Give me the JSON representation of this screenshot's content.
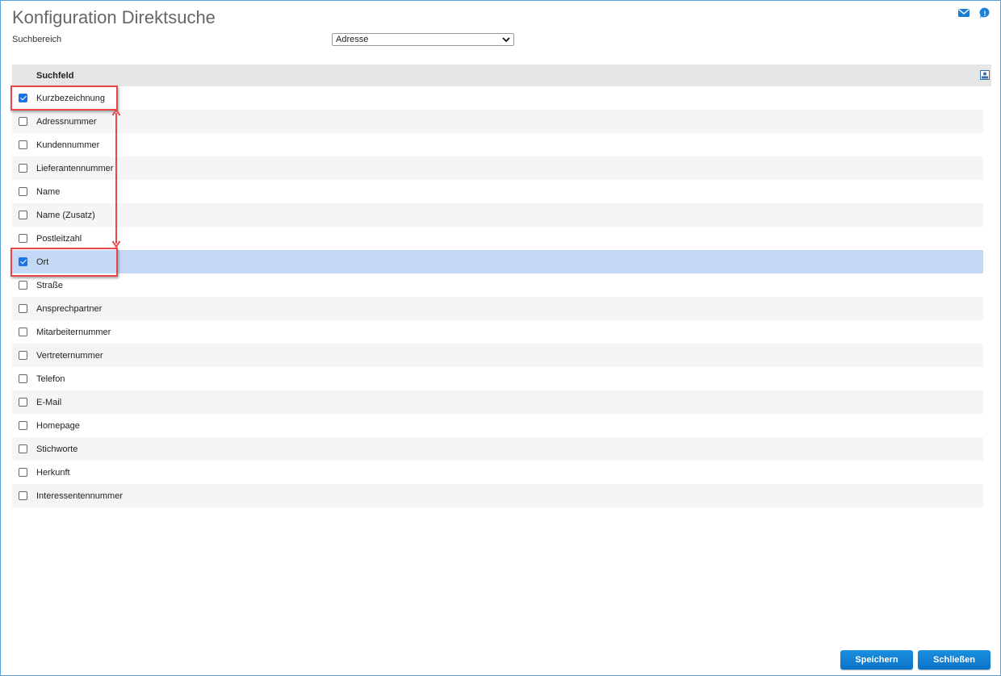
{
  "page": {
    "title": "Konfiguration Direktsuche"
  },
  "icons": {
    "mail": "mail-icon",
    "help": "help-icon",
    "column_settings": "column-settings-icon"
  },
  "filter": {
    "label": "Suchbereich",
    "selected": "Adresse"
  },
  "table": {
    "header": "Suchfeld",
    "rows": [
      {
        "label": "Kurzbezeichnung",
        "checked": true
      },
      {
        "label": "Adressnummer",
        "checked": false
      },
      {
        "label": "Kundennummer",
        "checked": false
      },
      {
        "label": "Lieferantennummer",
        "checked": false
      },
      {
        "label": "Name",
        "checked": false
      },
      {
        "label": "Name (Zusatz)",
        "checked": false
      },
      {
        "label": "Postleitzahl",
        "checked": false
      },
      {
        "label": "Ort",
        "checked": true,
        "selected": true
      },
      {
        "label": "Straße",
        "checked": false
      },
      {
        "label": "Ansprechpartner",
        "checked": false
      },
      {
        "label": "Mitarbeiternummer",
        "checked": false
      },
      {
        "label": "Vertreternummer",
        "checked": false
      },
      {
        "label": "Telefon",
        "checked": false
      },
      {
        "label": "E-Mail",
        "checked": false
      },
      {
        "label": "Homepage",
        "checked": false
      },
      {
        "label": "Stichworte",
        "checked": false
      },
      {
        "label": "Herkunft",
        "checked": false
      },
      {
        "label": "Interessentennummer",
        "checked": false
      }
    ]
  },
  "buttons": {
    "save": "Speichern",
    "close": "Schließen"
  },
  "colors": {
    "accent": "#1a73e8",
    "button": "#0b7fd4",
    "selection": "#c4d9f5",
    "annotation": "#e8474a"
  }
}
